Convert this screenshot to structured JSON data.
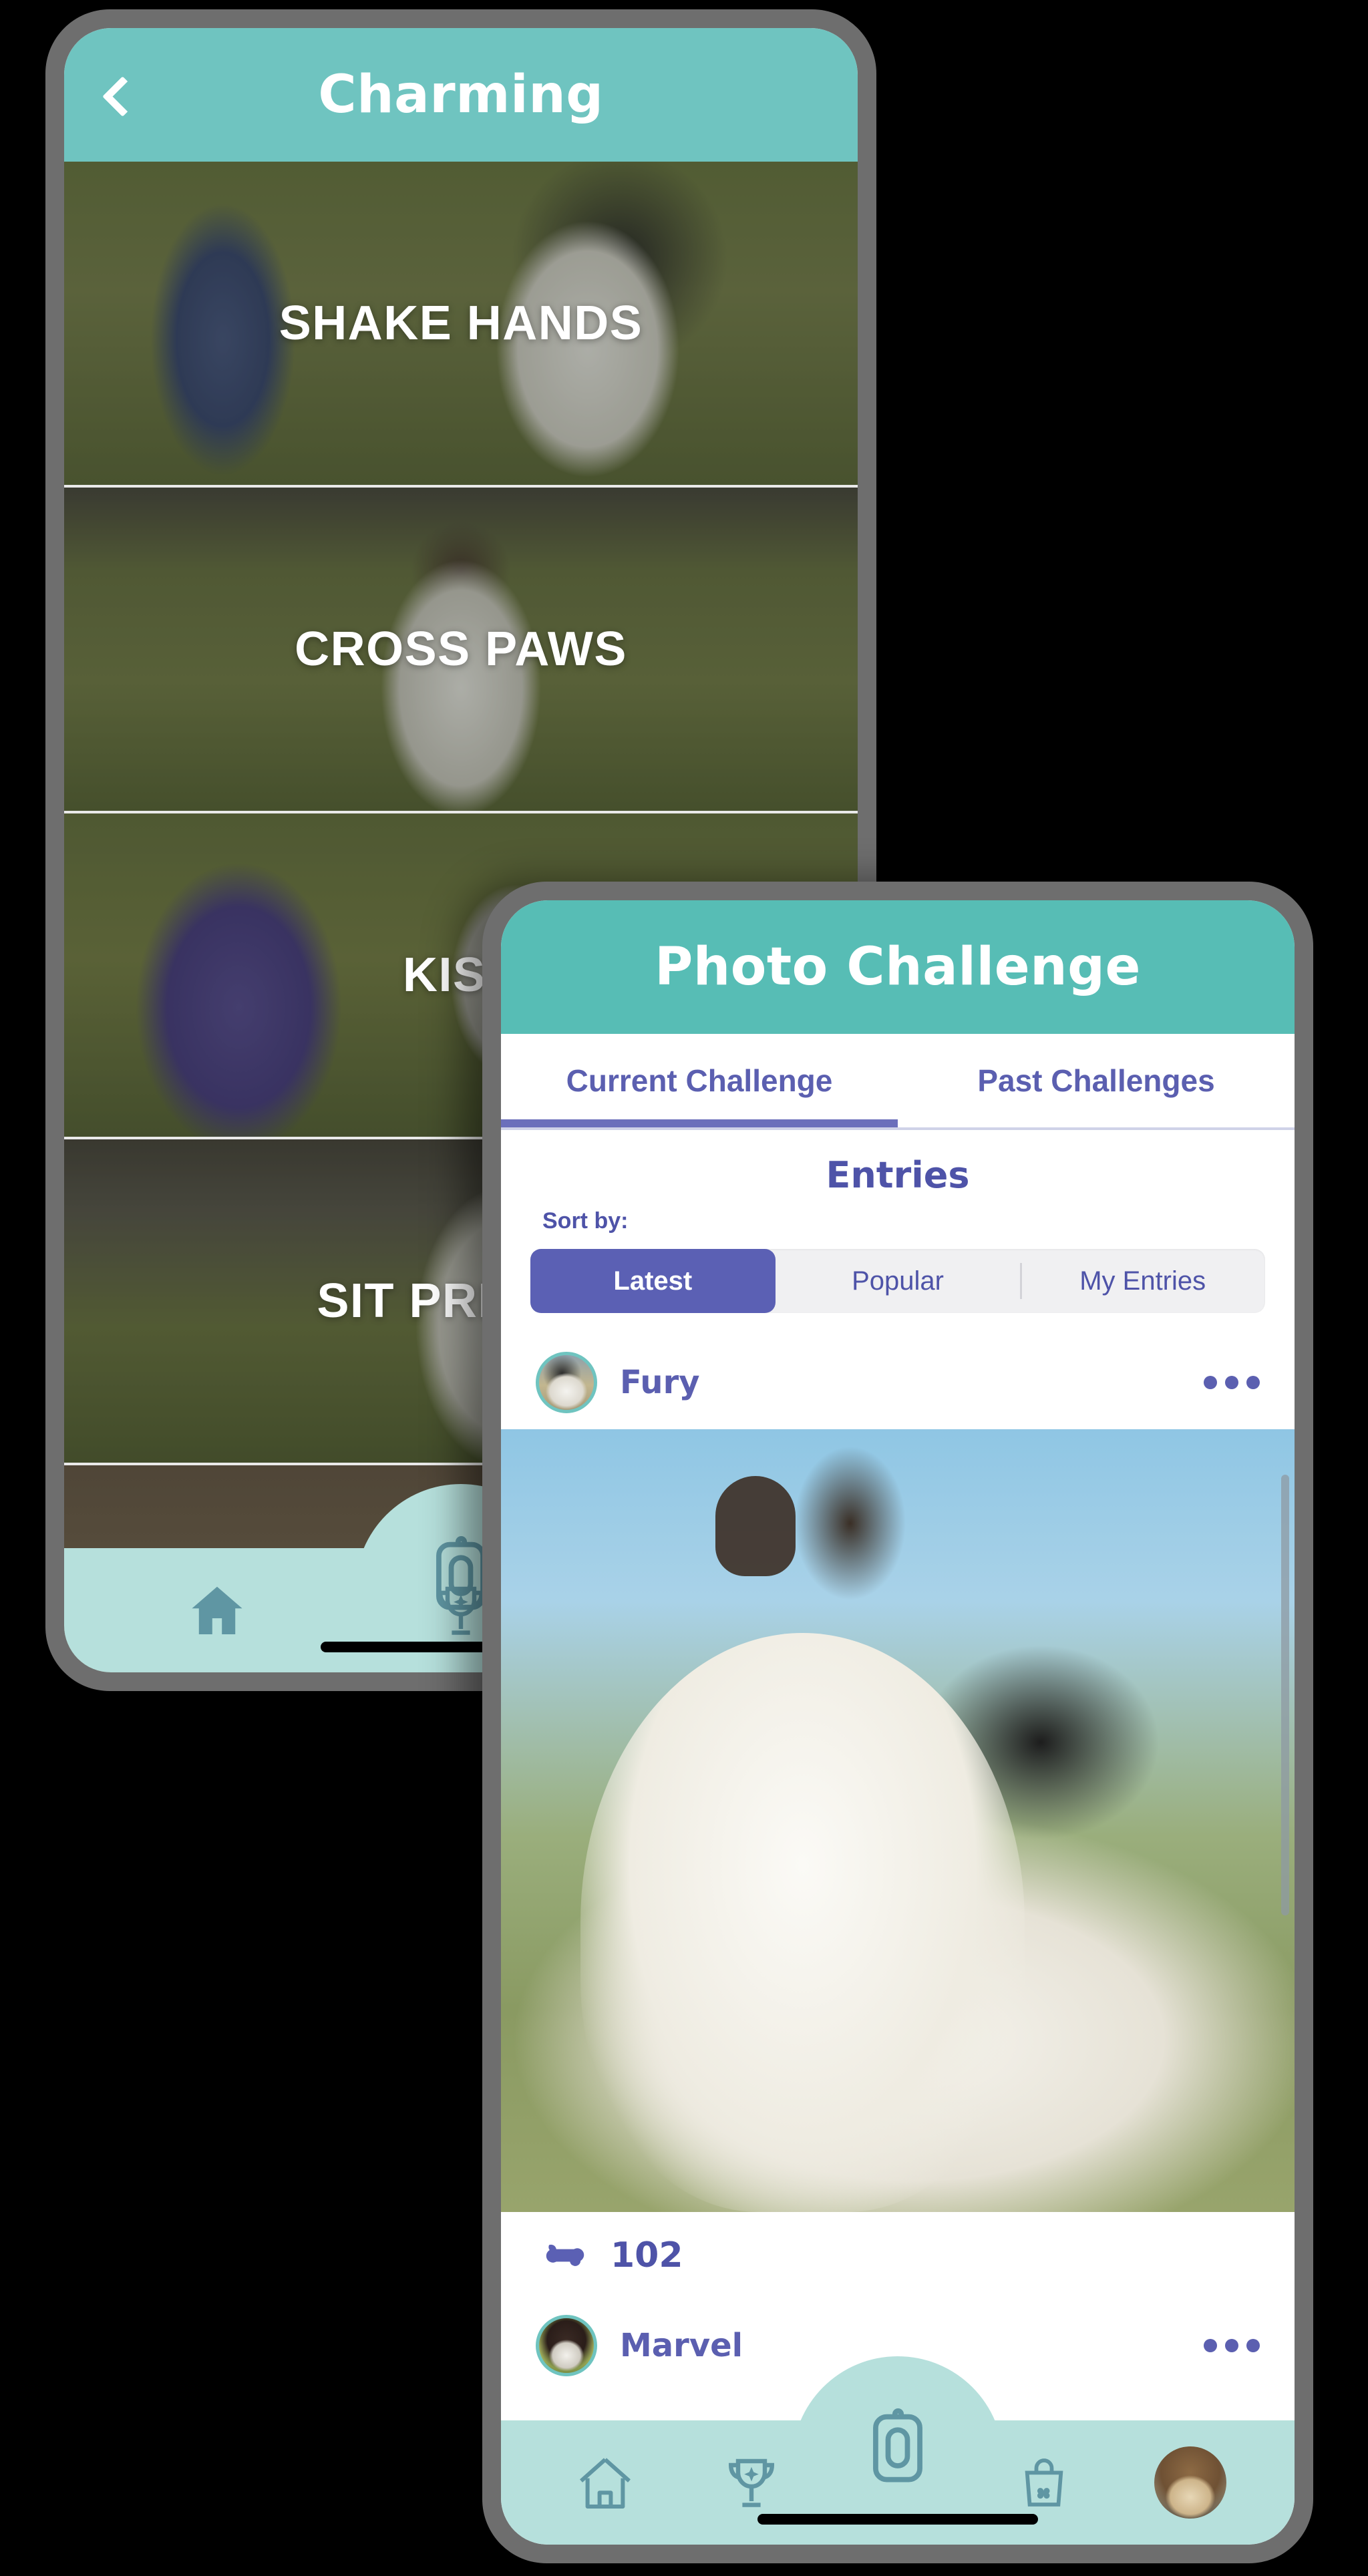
{
  "phone_one": {
    "header": {
      "title": "Charming",
      "back_icon": "chevron-left-icon"
    },
    "trick_cards": [
      {
        "label": "SHAKE HANDS"
      },
      {
        "label": "CROSS PAWS"
      },
      {
        "label": "KISS"
      },
      {
        "label": "SIT PRETTY"
      }
    ],
    "bottom_nav": [
      {
        "icon": "home-icon",
        "name": "home"
      },
      {
        "icon": "trophy-icon",
        "name": "achievements"
      },
      {
        "icon": "treat-dispenser-icon",
        "name": "treat"
      }
    ]
  },
  "phone_two": {
    "header": {
      "title": "Photo Challenge"
    },
    "tabs": [
      {
        "label": "Current Challenge",
        "active": true
      },
      {
        "label": "Past Challenges",
        "active": false
      }
    ],
    "entries_heading": "Entries",
    "sort_label": "Sort by:",
    "sort_options": [
      {
        "label": "Latest",
        "active": true
      },
      {
        "label": "Popular",
        "active": false
      },
      {
        "label": "My Entries",
        "active": false
      }
    ],
    "entries": [
      {
        "name": "Fury",
        "bone_count": "102",
        "menu_icon": "kebab-menu-icon",
        "bone_icon": "bone-icon"
      },
      {
        "name": "Marvel",
        "menu_icon": "kebab-menu-icon"
      }
    ],
    "bottom_nav": [
      {
        "icon": "home-icon",
        "name": "home"
      },
      {
        "icon": "trophy-icon",
        "name": "achievements"
      },
      {
        "icon": "treat-dispenser-icon",
        "name": "treat"
      },
      {
        "icon": "shopping-bag-icon",
        "name": "shop"
      },
      {
        "icon": "profile-avatar",
        "name": "profile"
      }
    ]
  },
  "colors": {
    "teal_header": "#6fc4c0",
    "teal_header_alt": "#57bdb5",
    "nav_background": "#b6e0dc",
    "icon_teal": "#5f96a3",
    "purple": "#5b5fb0",
    "purple_dark": "#4e53a8",
    "phone_frame": "#6e6e6e"
  }
}
